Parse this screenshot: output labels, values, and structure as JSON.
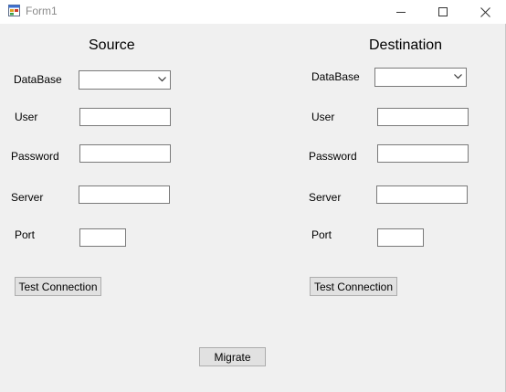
{
  "window": {
    "title": "Form1"
  },
  "source": {
    "heading": "Source",
    "database_label": "DataBase",
    "database_value": "",
    "user_label": "User",
    "user_value": "",
    "password_label": "Password",
    "password_value": "",
    "server_label": "Server",
    "server_value": "",
    "port_label": "Port",
    "port_value": "",
    "test_button": "Test Connection"
  },
  "destination": {
    "heading": "Destination",
    "database_label": "DataBase",
    "database_value": "",
    "user_label": "User",
    "user_value": "",
    "password_label": "Password",
    "password_value": "",
    "server_label": "Server",
    "server_value": "",
    "port_label": "Port",
    "port_value": "",
    "test_button": "Test Connection"
  },
  "migrate_button": "Migrate",
  "icons": {
    "app": "form-app-icon",
    "minimize": "minimize-icon",
    "maximize": "maximize-icon",
    "close": "close-icon",
    "dropdown": "chevron-down-icon"
  }
}
